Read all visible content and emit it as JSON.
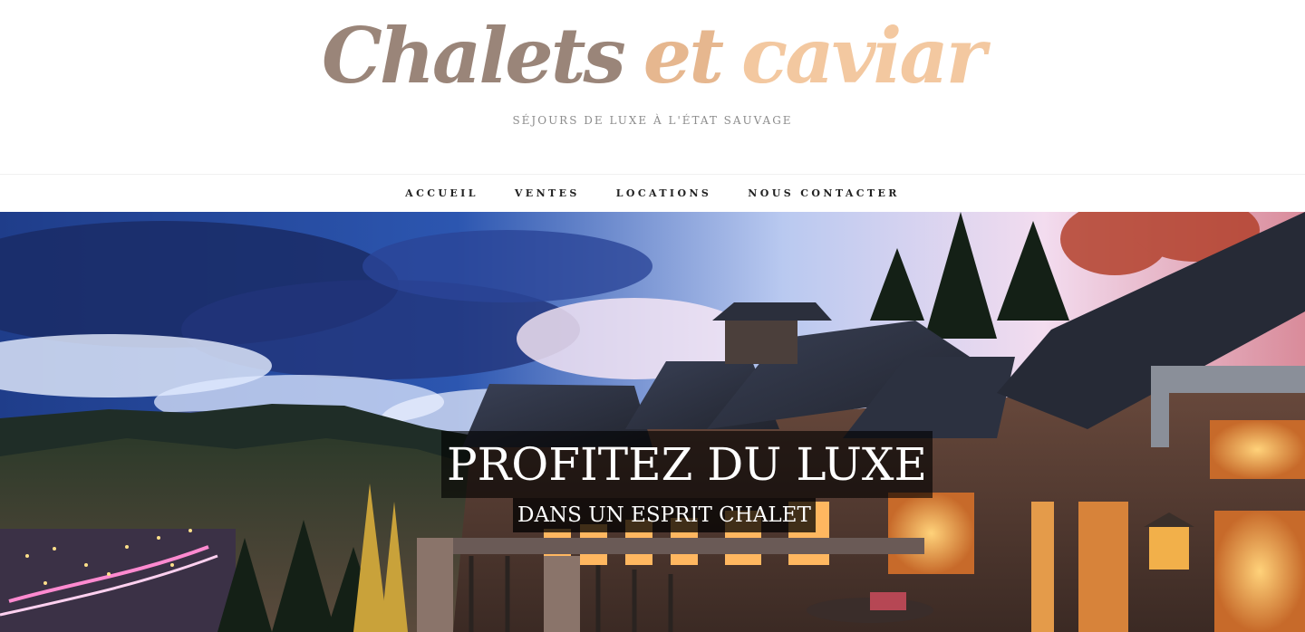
{
  "site": {
    "logo_text": {
      "part1": "Chalets",
      "part2": "et",
      "part3": "caviar"
    },
    "tagline": "SÉJOURS DE LUXE À L'ÉTAT SAUVAGE"
  },
  "nav": {
    "items": [
      {
        "label": "ACCUEIL"
      },
      {
        "label": "VENTES"
      },
      {
        "label": "LOCATIONS"
      },
      {
        "label": "NOUS CONTACTER"
      }
    ]
  },
  "hero": {
    "title": "PROFITEZ DU LUXE",
    "subtitle": "DANS UN ESPRIT CHALET",
    "image_subject": "luxury-mountain-chalet-at-dusk"
  },
  "colors": {
    "logo_dark": "#9a8579",
    "logo_light": "#f3c8a0",
    "tagline": "#8c8c8c",
    "nav_text": "#222222"
  }
}
